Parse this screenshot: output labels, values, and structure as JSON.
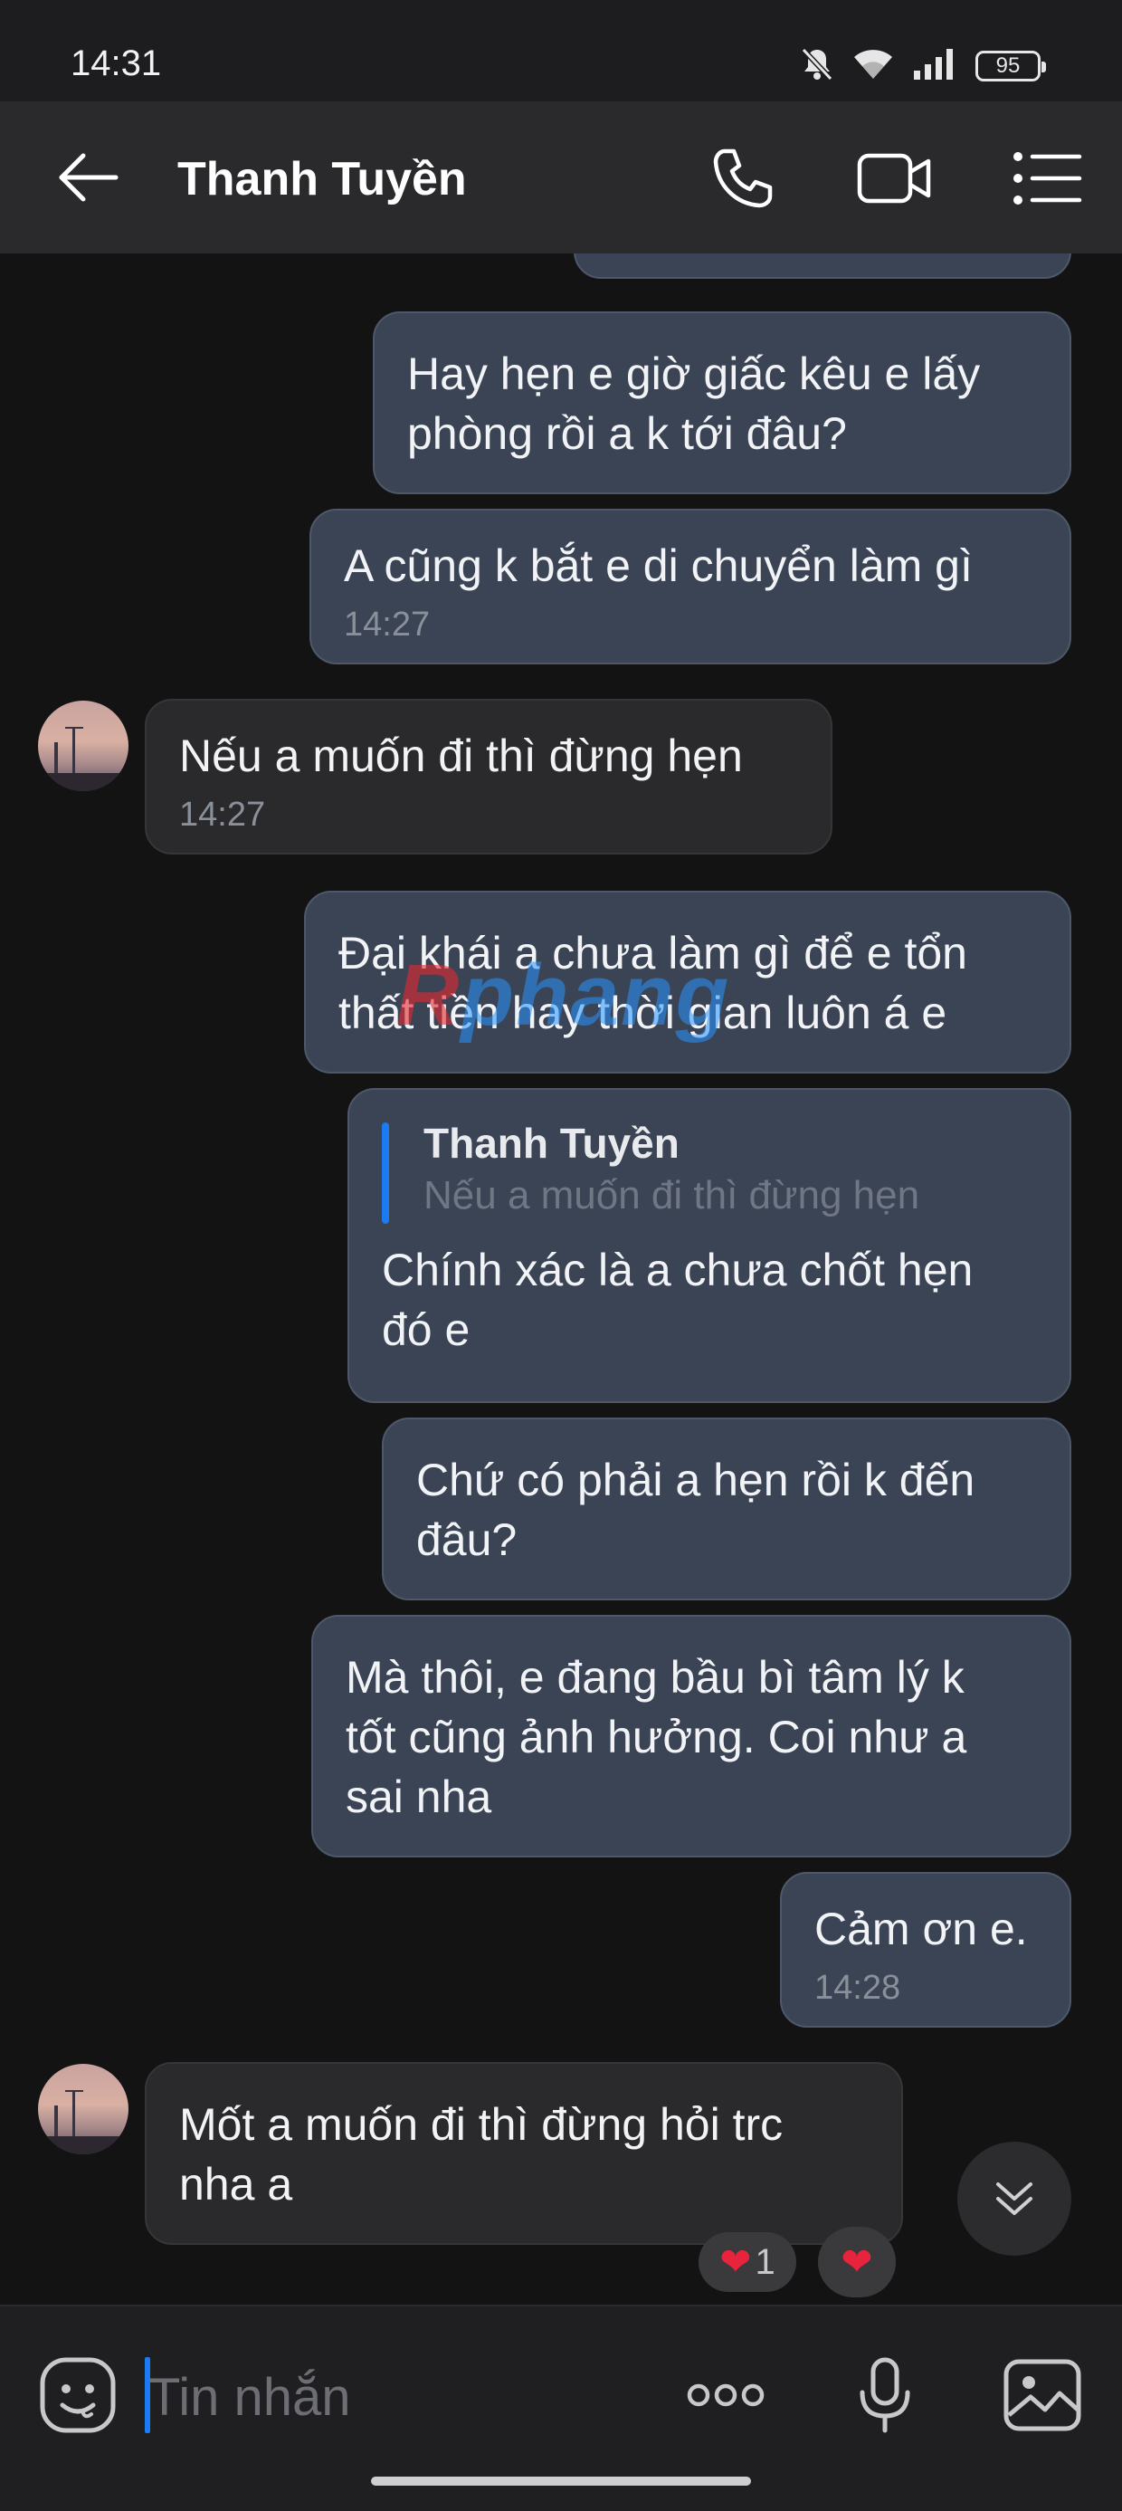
{
  "status_bar": {
    "time": "14:31",
    "battery": "95",
    "icons": [
      "bell-off-icon",
      "wifi-icon",
      "signal-icon",
      "battery-icon"
    ]
  },
  "header": {
    "contact_name": "Thanh Tuyền",
    "icons": [
      "back-arrow-icon",
      "phone-icon",
      "video-icon",
      "menu-icon"
    ]
  },
  "messages": [
    {
      "text": "Hay hẹn e giờ giấc kêu e lấy\nphòng rồi a k tới đâu?"
    },
    {
      "text": "A cũng k bắt e di chuyển làm gì",
      "time": "14:27"
    },
    {
      "text": "Nếu a muốn đi thì đừng hẹn",
      "time": "14:27"
    },
    {
      "text": "Đại khái a chưa làm gì để e tổn\nthất tiền hay thời gian luôn á e"
    },
    {
      "quote_name": "Thanh Tuyền",
      "quote_text": "Nếu a muốn đi thì đừng hẹn",
      "text": "Chính xác là a chưa chốt hẹn\nđó e"
    },
    {
      "text": "Chứ có phải a hẹn rồi k đến\nđâu?"
    },
    {
      "text": "Mà thôi, e đang bầu bì tâm lý k\ntốt cũng ảnh hưởng. Coi như a\nsai nha"
    },
    {
      "text": "Cảm ơn e.",
      "time": "14:28"
    },
    {
      "text": "Mốt a muốn đi thì đừng hỏi trc\nnha a"
    }
  ],
  "reactions": {
    "count": "1",
    "icon": "heart-icon"
  },
  "watermark": {
    "part1": "R",
    "part2": "phang"
  },
  "composer": {
    "placeholder": "Tin nhắn",
    "icons": [
      "emoji-icon",
      "more-dots-icon",
      "microphone-icon",
      "image-icon"
    ]
  },
  "colors": {
    "outgoing_bubble": "#3b4454",
    "incoming_bubble": "#2a2a2c",
    "accent": "#1a7bf2",
    "background": "#131314"
  }
}
